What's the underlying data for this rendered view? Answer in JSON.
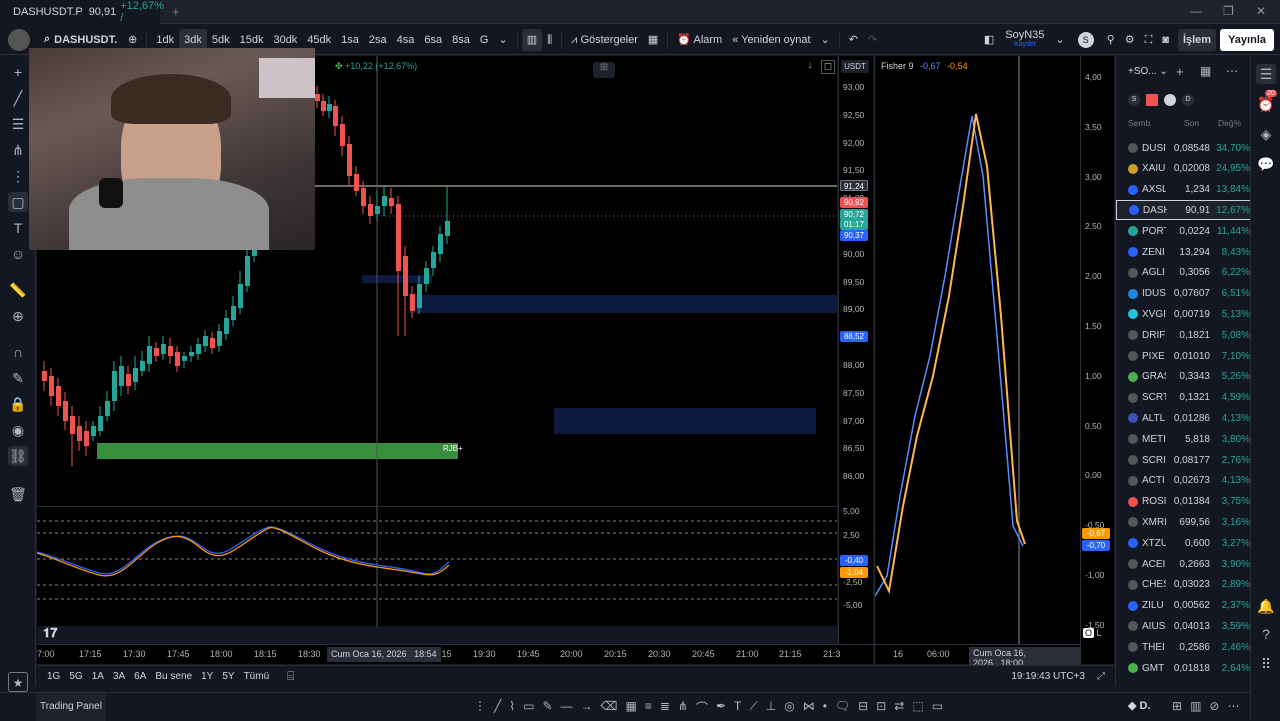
{
  "tab": {
    "title": "DASHUSDT.P",
    "price": "90,91",
    "change": "+12,67% /"
  },
  "window": {
    "minimize": "—",
    "restore": "❐",
    "close": "✕"
  },
  "toolbar": {
    "symbol": "DASHUSDT.",
    "intervals": [
      "1dk",
      "3dk",
      "5dk",
      "15dk",
      "30dk",
      "45dk",
      "1sa",
      "2sa",
      "4sa",
      "6sa",
      "8sa",
      "G"
    ],
    "active_interval": "3dk",
    "indicators": "Göstergeler",
    "alarm": "Alarm",
    "replay": "Yeniden oynat",
    "layout_name": "SoyN35",
    "layout_sub": "Kaydet",
    "trade": "İşlem",
    "publish": "Yayınla"
  },
  "legend": {
    "change": "+10,22 (+12,67%)",
    "currency": "USDT"
  },
  "chart_labels": {
    "rjb": "RJB+"
  },
  "price_axis": {
    "ticks": [
      "93,00",
      "92,50",
      "92,00",
      "91,50",
      "91,00",
      "90,50",
      "90,00",
      "89,50",
      "89,00",
      "88,50",
      "88,00",
      "87,50",
      "87,00",
      "86,50",
      "86,00"
    ],
    "last_price": "91,24",
    "label_red": "90,92",
    "label_teal_price": "90,72",
    "label_teal_timer": "01:17",
    "label_blue": "90,37",
    "label_blue2": "88,52",
    "osc_ticks": [
      "5,00",
      "2,50",
      "0,00",
      "-2,50",
      "-5,00"
    ],
    "osc_label_blue": "-0,40",
    "osc_label_orange": "-1,04"
  },
  "time_axis": {
    "ticks": [
      "7:00",
      "17:15",
      "17:30",
      "17:45",
      "18:00",
      "18:15",
      "18:30",
      "19:15",
      "19:30",
      "19:45",
      "20:00",
      "20:15",
      "20:30",
      "20:45",
      "21:00",
      "21:15",
      "21:3"
    ],
    "cursor": "Cum Oca 16, 2026",
    "cursor_time": "18:54"
  },
  "fisher": {
    "title": "Fisher 9",
    "v1": "-0,67",
    "v2": "-0,54",
    "axis": [
      "4,00",
      "3,50",
      "3,00",
      "2,50",
      "2,00",
      "1,50",
      "1,00",
      "0,50",
      "0,00",
      "-0,50",
      "-1,00",
      "-1,50"
    ],
    "label_orange": "-0,67",
    "label_blue": "-0,70",
    "time_ticks": [
      "16",
      "06:00"
    ],
    "cursor": "Cum Oca 16, 2026",
    "cursor_time": "18:00"
  },
  "ranges": [
    "1G",
    "5G",
    "1A",
    "3A",
    "6A",
    "Bu sene",
    "1Y",
    "5Y",
    "Tümü"
  ],
  "clock": "19:19:43 UTC+3",
  "panel_label": "Trading Panel",
  "watchlist": {
    "title": "+SO...",
    "headers": {
      "symbol": "Semb",
      "last": "Son",
      "change": "Değ%"
    },
    "rows": [
      {
        "sym": "DUSI",
        "last": "0,08548",
        "chg": "34,70%"
      },
      {
        "sym": "XAIU",
        "last": "0,02008",
        "chg": "24,95%"
      },
      {
        "sym": "AXSL",
        "last": "1,234",
        "chg": "13,84%"
      },
      {
        "sym": "DASH",
        "last": "90,91",
        "chg": "12,67%"
      },
      {
        "sym": "PORT",
        "last": "0,0224",
        "chg": "11,44%"
      },
      {
        "sym": "ZENI",
        "last": "13,294",
        "chg": "8,43%"
      },
      {
        "sym": "AGLI",
        "last": "0,3056",
        "chg": "6,22%"
      },
      {
        "sym": "IDUS",
        "last": "0,07607",
        "chg": "6,51%"
      },
      {
        "sym": "XVGI",
        "last": "0,00719",
        "chg": "5,13%"
      },
      {
        "sym": "DRIF",
        "last": "0,1821",
        "chg": "5,08%"
      },
      {
        "sym": "PIXE",
        "last": "0,01010",
        "chg": "7,10%"
      },
      {
        "sym": "GRAS",
        "last": "0,3343",
        "chg": "5,26%"
      },
      {
        "sym": "SCRT",
        "last": "0,1321",
        "chg": "4,59%"
      },
      {
        "sym": "ALTL",
        "last": "0,01286",
        "chg": "4,13%"
      },
      {
        "sym": "METI",
        "last": "5,818",
        "chg": "3,80%"
      },
      {
        "sym": "SCRI",
        "last": "0,08177",
        "chg": "2,76%"
      },
      {
        "sym": "ACTI",
        "last": "0,02673",
        "chg": "4,13%"
      },
      {
        "sym": "ROSI",
        "last": "0,01384",
        "chg": "3,75%"
      },
      {
        "sym": "XMRI",
        "last": "699,56",
        "chg": "3,16%"
      },
      {
        "sym": "XTZU",
        "last": "0,600",
        "chg": "3,27%"
      },
      {
        "sym": "ACEI",
        "last": "0,2663",
        "chg": "3,90%"
      },
      {
        "sym": "CHES",
        "last": "0,03023",
        "chg": "2,89%"
      },
      {
        "sym": "ZILU",
        "last": "0,00562",
        "chg": "2,37%"
      },
      {
        "sym": "AIUS",
        "last": "0,04013",
        "chg": "3,59%"
      },
      {
        "sym": "THEI",
        "last": "0,2586",
        "chg": "2,46%"
      },
      {
        "sym": "GMT",
        "last": "0,01818",
        "chg": "2,64%"
      }
    ]
  },
  "notif_count": "20",
  "colors": {
    "up": "#26a69a",
    "down": "#ef5350",
    "accent": "#2962ff",
    "orange": "#ff9800",
    "green_box": "#388e3c"
  }
}
